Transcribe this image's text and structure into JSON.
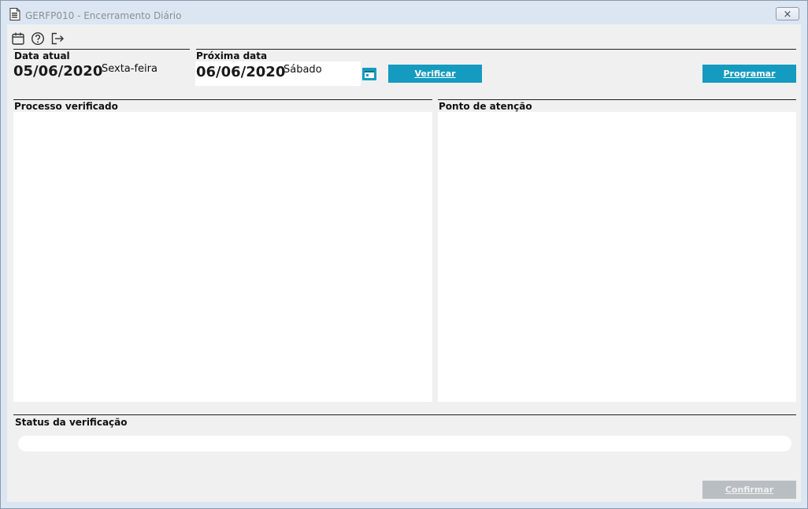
{
  "window": {
    "title": "GERFP010 - Encerramento Diário",
    "close_glyph": "⨯"
  },
  "toolbar": {
    "icons": [
      "calendar-icon",
      "help-icon",
      "exit-icon"
    ]
  },
  "data_atual": {
    "label": "Data atual",
    "date": "05/06/2020",
    "weekday": "Sexta-feira"
  },
  "proxima_data": {
    "label": "Próxima data",
    "date": "06/06/2020",
    "weekday": "Sábado"
  },
  "buttons": {
    "verificar": "Verificar",
    "programar": "Programar",
    "confirmar": "Confirmar"
  },
  "panels": {
    "processo": "Processo verificado",
    "ponto": "Ponto de atenção"
  },
  "status": {
    "label": "Status da verificação",
    "progress": 0
  },
  "colors": {
    "accent": "#149bbf",
    "disabled": "#b9bec3",
    "titlebar": "#dbe6f2",
    "client": "#f0f0f0"
  }
}
